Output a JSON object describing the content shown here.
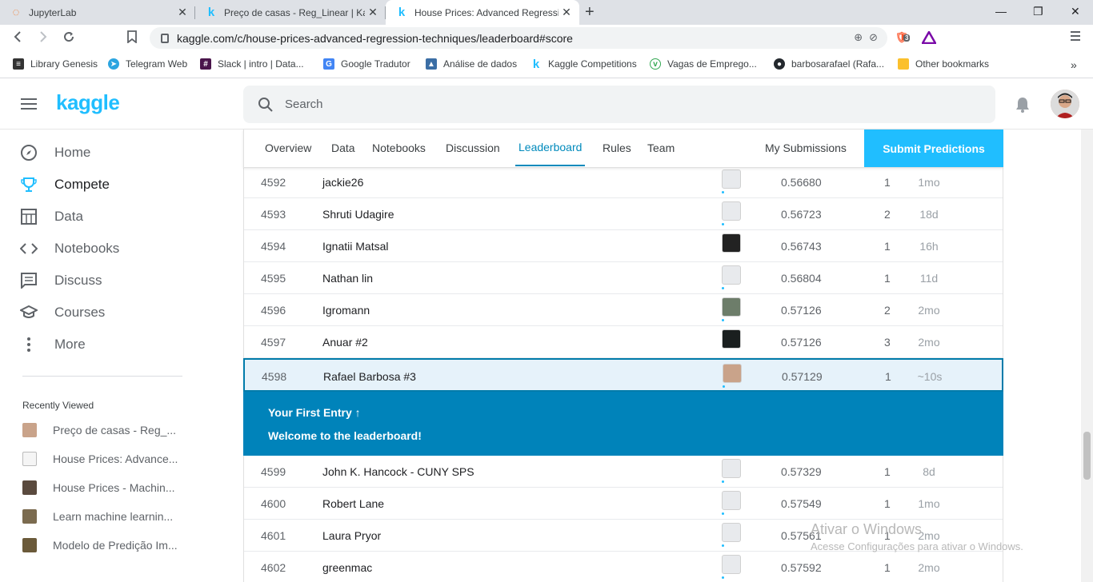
{
  "browser": {
    "tabs": [
      {
        "title": "JupyterLab",
        "icon": "jupyter-icon"
      },
      {
        "title": "Preço de casas - Reg_Linear | Kagg",
        "icon": "kaggle-k-icon"
      },
      {
        "title": "House Prices: Advanced Regressio",
        "icon": "kaggle-k-icon"
      }
    ],
    "url": "kaggle.com/c/house-prices-advanced-regression-techniques/leaderboard#score",
    "brave_badge": "3",
    "bookmarks": [
      {
        "label": "Library Genesis",
        "color": "#333333"
      },
      {
        "label": "Telegram Web",
        "color": "#2ca5e0"
      },
      {
        "label": "Slack | intro | Data...",
        "color": "#4a154b"
      },
      {
        "label": "Google Tradutor",
        "color": "#4285f4"
      },
      {
        "label": "Análise de dados",
        "color": "#3b6ea5"
      },
      {
        "label": "Kaggle Competitions",
        "color": "#20beff"
      },
      {
        "label": "Vagas de Emprego...",
        "color": "#34a853"
      },
      {
        "label": "barbosarafael (Rafa...",
        "color": "#24292e"
      },
      {
        "label": "Other bookmarks",
        "color": "#fbc02d"
      }
    ]
  },
  "kaggle": {
    "logo": "kaggle",
    "search_placeholder": "Search",
    "sidebar": [
      {
        "label": "Home"
      },
      {
        "label": "Compete"
      },
      {
        "label": "Data"
      },
      {
        "label": "Notebooks"
      },
      {
        "label": "Discuss"
      },
      {
        "label": "Courses"
      },
      {
        "label": "More"
      }
    ],
    "recently_viewed_title": "Recently Viewed",
    "recently_viewed": [
      {
        "label": "Preço de casas - Reg_..."
      },
      {
        "label": "House Prices: Advance..."
      },
      {
        "label": "House Prices - Machin..."
      },
      {
        "label": "Learn machine learnin..."
      },
      {
        "label": "Modelo de Predição Im..."
      }
    ],
    "tabs": [
      "Overview",
      "Data",
      "Notebooks",
      "Discussion",
      "Leaderboard",
      "Rules",
      "Team"
    ],
    "my_submissions": "My Submissions",
    "submit_predictions": "Submit Predictions",
    "rows_before": [
      {
        "rank": "4592",
        "team": "jackie26",
        "score": "0.56680",
        "entries": "1",
        "last": "1mo"
      },
      {
        "rank": "4593",
        "team": "Shruti Udagire",
        "score": "0.56723",
        "entries": "2",
        "last": "18d"
      },
      {
        "rank": "4594",
        "team": "Ignatii Matsal",
        "score": "0.56743",
        "entries": "1",
        "last": "16h"
      },
      {
        "rank": "4595",
        "team": "Nathan lin",
        "score": "0.56804",
        "entries": "1",
        "last": "11d"
      },
      {
        "rank": "4596",
        "team": "Igromann",
        "score": "0.57126",
        "entries": "2",
        "last": "2mo"
      },
      {
        "rank": "4597",
        "team": "Anuar #2",
        "score": "0.57126",
        "entries": "3",
        "last": "2mo"
      }
    ],
    "my_row": {
      "rank": "4598",
      "team": "Rafael Barbosa #3",
      "score": "0.57129",
      "entries": "1",
      "last": "~10s"
    },
    "banner": {
      "title": "Your First Entry ↑",
      "subtitle": "Welcome to the leaderboard!"
    },
    "rows_after": [
      {
        "rank": "4599",
        "team": "John K. Hancock - CUNY SPS",
        "score": "0.57329",
        "entries": "1",
        "last": "8d"
      },
      {
        "rank": "4600",
        "team": "Robert Lane",
        "score": "0.57549",
        "entries": "1",
        "last": "1mo"
      },
      {
        "rank": "4601",
        "team": "Laura Pryor",
        "score": "0.57561",
        "entries": "1",
        "last": "2mo"
      },
      {
        "rank": "4602",
        "team": "greenmac",
        "score": "0.57592",
        "entries": "1",
        "last": "2mo"
      }
    ]
  },
  "watermark": {
    "line1": "Ativar o Windows",
    "line2": "Acesse Configurações para ativar o Windows."
  }
}
